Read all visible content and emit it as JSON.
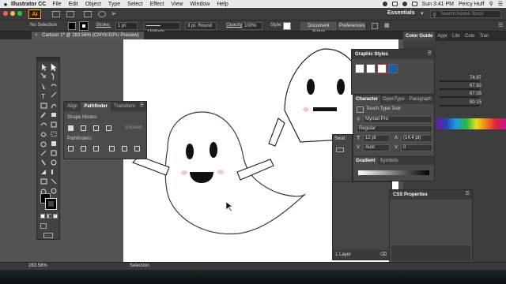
{
  "menubar": {
    "app_name": "Illustrator CC",
    "items": [
      "File",
      "Edit",
      "Object",
      "Type",
      "Select",
      "Effect",
      "View",
      "Window",
      "Help"
    ],
    "clock": "Sun 3:41 PM",
    "user": "Percy Huff"
  },
  "appbar": {
    "logo": "Ai",
    "workspace": "Essentials",
    "search_placeholder": "Search Adobe Stock"
  },
  "control": {
    "selection": "No Selection",
    "stroke_label": "Stroke:",
    "stroke_weight": "1 pt",
    "profile": "Uniform",
    "brush": "3 pt. Round",
    "opacity_label": "Opacity:",
    "opacity": "100%",
    "style_label": "Style:",
    "doc_setup": "Document Setup",
    "preferences": "Preferences"
  },
  "document": {
    "tab_title": "Cartoon 1* @ 283.58% (CMYK/GPU Preview)"
  },
  "pathfinder": {
    "tabs": [
      "Align",
      "Pathfinder",
      "Transform"
    ],
    "active_tab": "Pathfinder",
    "shape_modes_label": "Shape Modes:",
    "pathfinders_label": "Pathfinders:",
    "expand_label": "Expand"
  },
  "dock": {
    "tabs": [
      "Color Guide",
      "Appr",
      "Libr",
      "Colo",
      "Tran"
    ],
    "active_tab": "Color Guide",
    "slider_values": [
      "74.97",
      "67.92",
      "67.05",
      "90.15"
    ]
  },
  "graphic_styles": {
    "title": "Graphic Styles"
  },
  "character": {
    "tabs": [
      "Character",
      "OpenType",
      "Paragraph"
    ],
    "touch_type": "Touch Type Tool",
    "font_family": "Myriad Pro",
    "font_style": "Regular",
    "font_size": "12 pt",
    "leading": "(14.4 pt)",
    "kerning": "Auto",
    "tracking": "0"
  },
  "swatches": {
    "tab": "Swat"
  },
  "gradient": {
    "tabs": [
      "Gradient",
      "Symbols"
    ]
  },
  "layers": {
    "count": "1 Layer"
  },
  "css": {
    "title": "CSS Properties"
  },
  "status": {
    "zoom": "283.58%",
    "tool": "Selection"
  },
  "colors": {
    "accent": "#f7a11a",
    "ghost_stroke": "#2d3a5c",
    "cheek": "#f4c8cc",
    "ui_dark": "#3c3c3c",
    "artboard": "#ffffff"
  }
}
